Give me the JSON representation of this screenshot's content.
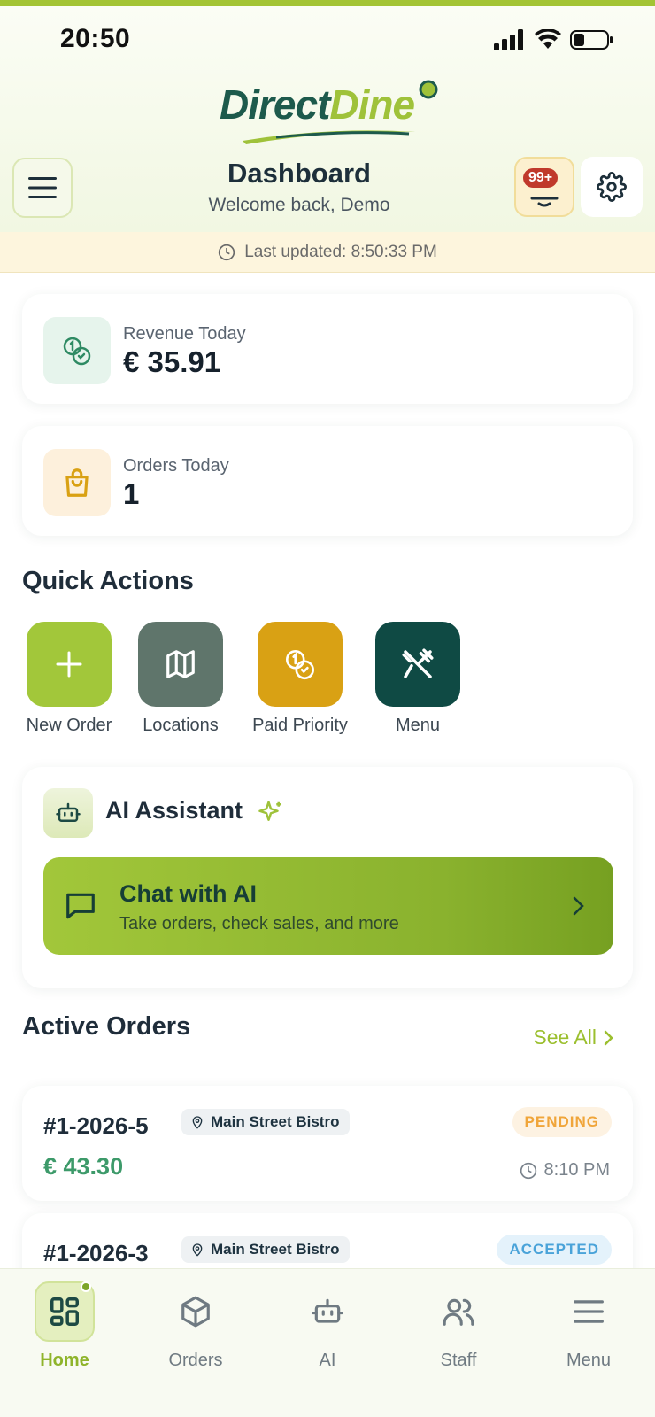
{
  "status_bar": {
    "time": "20:50"
  },
  "brand": {
    "part1": "Direct",
    "part2": "Dine"
  },
  "header": {
    "title": "Dashboard",
    "subtitle": "Welcome back, Demo",
    "notification_count": "99+"
  },
  "last_updated": "Last updated: 8:50:33 PM",
  "stats": [
    {
      "label": "Revenue Today",
      "value": "€ 35.91"
    },
    {
      "label": "Orders Today",
      "value": "1"
    }
  ],
  "quick_actions": {
    "title": "Quick Actions",
    "items": [
      {
        "label": "New Order",
        "icon": "plus-icon",
        "color": "#a2c73a"
      },
      {
        "label": "Locations",
        "icon": "map-icon",
        "color": "#5f756b"
      },
      {
        "label": "Paid Priority",
        "icon": "coins-icon",
        "color": "#d9a114"
      },
      {
        "label": "Menu",
        "icon": "utensils-icon",
        "color": "#0f4a44"
      }
    ]
  },
  "ai_assistant": {
    "title": "AI Assistant",
    "chat_title": "Chat with AI",
    "chat_subtitle": "Take orders, check sales, and more"
  },
  "active_orders": {
    "title": "Active Orders",
    "see_all": "See All",
    "orders": [
      {
        "id": "#1-2026-5",
        "location": "Main Street Bistro",
        "status": "PENDING",
        "amount": "€ 43.30",
        "time": "8:10 PM"
      },
      {
        "id": "#1-2026-3",
        "location": "Main Street Bistro",
        "status": "ACCEPTED"
      }
    ]
  },
  "bottom_nav": {
    "items": [
      {
        "label": "Home",
        "icon": "grid-icon",
        "active": true
      },
      {
        "label": "Orders",
        "icon": "box-icon"
      },
      {
        "label": "AI",
        "icon": "robot-icon"
      },
      {
        "label": "Staff",
        "icon": "users-icon"
      },
      {
        "label": "Menu",
        "icon": "menu-icon"
      }
    ]
  },
  "colors": {
    "brand_green": "#a2c73a",
    "brand_dark": "#1d5a4c",
    "pending": "#f0a53a",
    "accepted": "#4aa3d9"
  }
}
